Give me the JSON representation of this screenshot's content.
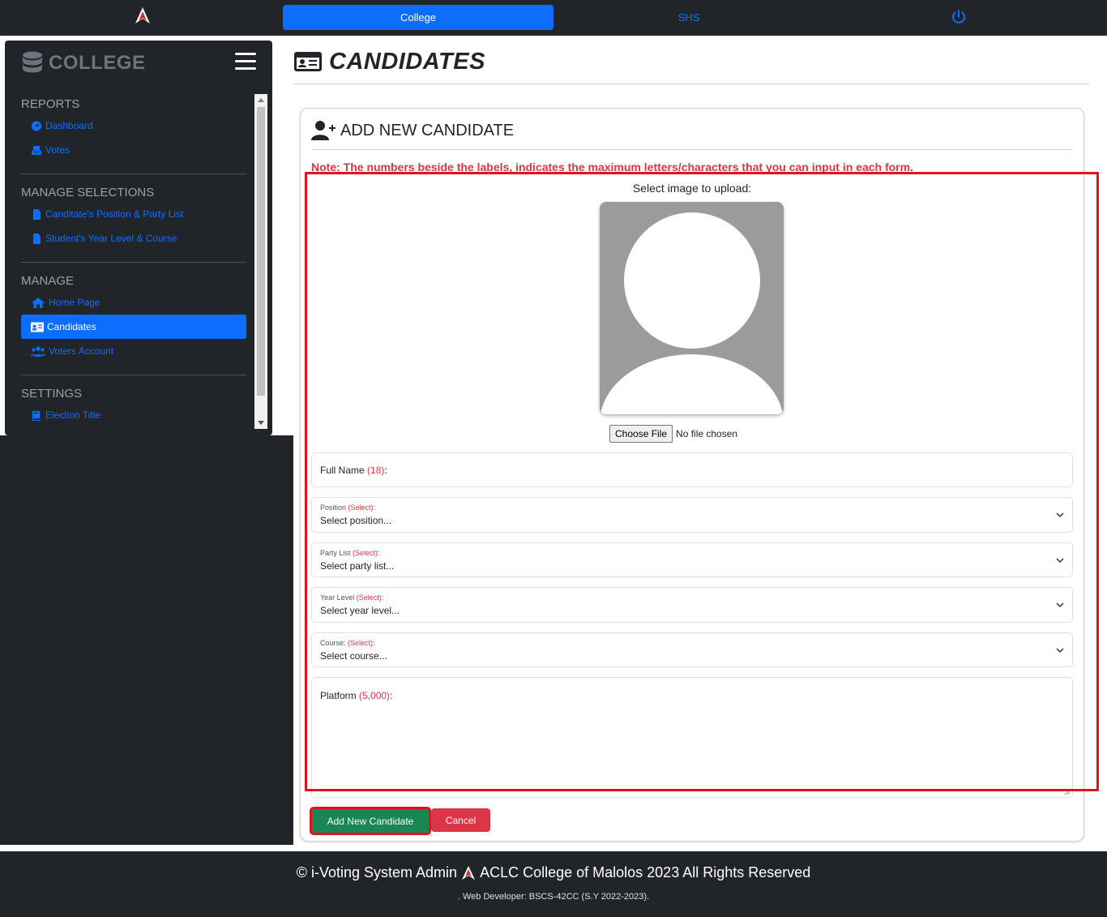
{
  "topbar": {
    "college_label": "College",
    "shs_label": "SHS"
  },
  "sidebar": {
    "title": "COLLEGE",
    "sections": [
      {
        "title": "REPORTS",
        "items": [
          {
            "label": "Dashboard",
            "icon": "gauge-icon"
          },
          {
            "label": "Votes",
            "icon": "vote-box-icon"
          }
        ]
      },
      {
        "title": "MANAGE SELECTIONS",
        "items": [
          {
            "label": "Canditate's Position & Party List",
            "icon": "file-icon"
          },
          {
            "label": "Student's Year Level & Course",
            "icon": "file-icon"
          }
        ]
      },
      {
        "title": "MANAGE",
        "items": [
          {
            "label": "Home Page",
            "icon": "home-icon"
          },
          {
            "label": "Candidates",
            "icon": "id-card-icon",
            "active": true
          },
          {
            "label": "Voters Account",
            "icon": "users-icon"
          }
        ]
      },
      {
        "title": "SETTINGS",
        "items": [
          {
            "label": "Election Title",
            "icon": "book-icon"
          }
        ]
      }
    ]
  },
  "page": {
    "title": "CANDIDATES"
  },
  "card": {
    "header": "ADD NEW CANDIDATE",
    "note": "Note: The numbers beside the labels, indicates the maximum letters/characters that you can input in each form.",
    "upload_label": "Select image to upload:",
    "file_button": "Choose File",
    "file_status": "No file chosen",
    "full_name": {
      "label": "Full Name",
      "max": "(18)",
      "suffix": ":"
    },
    "position": {
      "label": "Position",
      "max": "(Select)",
      "suffix": ":",
      "value": "Select position..."
    },
    "party_list": {
      "label": "Party List",
      "max": "(Select)",
      "suffix": ":",
      "value": "Select party list..."
    },
    "year_level": {
      "label": "Year Level",
      "max": "(Select)",
      "suffix": ":",
      "value": "Select year level..."
    },
    "course": {
      "label": "Course:",
      "max": "(Select)",
      "suffix": ":",
      "value": "Select course..."
    },
    "platform": {
      "label": "Platform",
      "max": "(5,000)",
      "suffix": ":"
    },
    "add_button": "Add New Candidate",
    "cancel_button": "Cancel"
  },
  "footer": {
    "line1_left": "© i-Voting System Admin",
    "line1_right": "ACLC College of Malolos 2023 All Rights Reserved",
    "line2": ". Web Developer: BSCS-42CC (S.Y 2022-2023)."
  },
  "colors": {
    "primary": "#0d6efd",
    "dark": "#212529",
    "success": "#198754",
    "danger": "#dc3545",
    "highlight": "#e0141f"
  }
}
